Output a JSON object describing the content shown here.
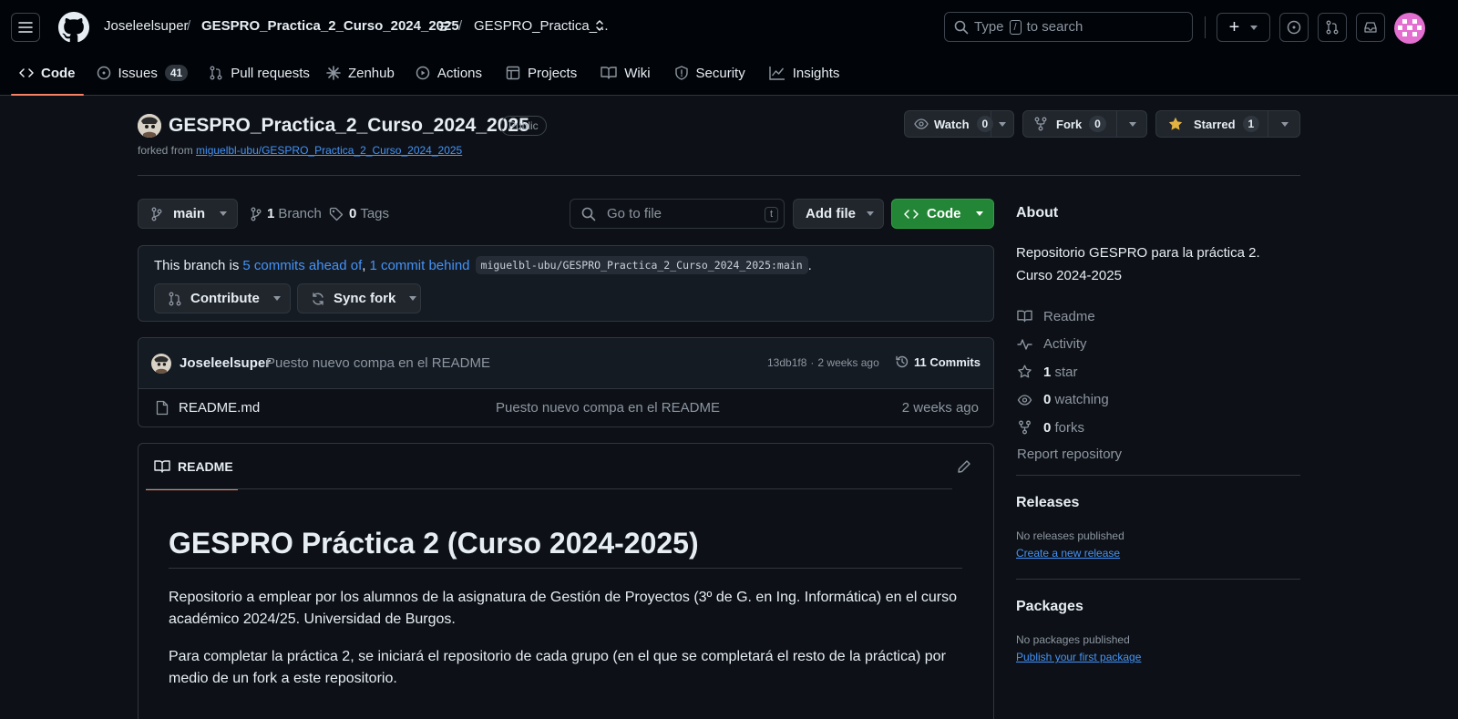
{
  "header": {
    "owner": "Joseleelsuper",
    "separator": "/",
    "repo": "GESPRO_Practica_2_Curso_2024_2025",
    "branch_switcher": "GESPRO_Practica_...",
    "search_text_before": "Type",
    "search_key": "/",
    "search_text_after": "to search",
    "plus_label": "+"
  },
  "nav": {
    "tabs": [
      {
        "label": "Code",
        "icon": "code-icon"
      },
      {
        "label": "Issues",
        "icon": "issue-icon",
        "count": "41"
      },
      {
        "label": "Pull requests",
        "icon": "pull-request-icon"
      },
      {
        "label": "Zenhub",
        "icon": "zenhub-icon"
      },
      {
        "label": "Actions",
        "icon": "play-icon"
      },
      {
        "label": "Projects",
        "icon": "table-icon"
      },
      {
        "label": "Wiki",
        "icon": "book-icon"
      },
      {
        "label": "Security",
        "icon": "shield-icon"
      },
      {
        "label": "Insights",
        "icon": "graph-icon"
      }
    ]
  },
  "repo": {
    "name": "GESPRO_Practica_2_Curso_2024_2025",
    "visibility": "Public",
    "forked_prefix": "forked from",
    "forked_from": "miguelbl-ubu/GESPRO_Practica_2_Curso_2024_2025",
    "watch_label": "Watch",
    "watch_count": "0",
    "fork_label": "Fork",
    "fork_count": "0",
    "star_label": "Starred",
    "star_count": "1"
  },
  "toolbar": {
    "branch": "main",
    "branch_count": "1",
    "branch_label": "Branch",
    "tag_count": "0",
    "tag_label": "Tags",
    "goto_placeholder": "Go to file",
    "goto_key": "t",
    "add_file": "Add file",
    "code": "Code"
  },
  "branch_status": {
    "prefix": "This branch is",
    "ahead": "5 commits ahead of",
    "comma": ",",
    "behind": "1 commit behind",
    "upstream": "miguelbl-ubu/GESPRO_Practica_2_Curso_2024_2025:main",
    "suffix": ".",
    "contribute": "Contribute",
    "sync": "Sync fork"
  },
  "commit": {
    "author": "Joseleelsuper",
    "message": "Puesto nuevo compa en el README",
    "sha": "13db1f8",
    "dot": "·",
    "time": "2 weeks ago",
    "commits_count": "11 Commits"
  },
  "files": [
    {
      "name": "README.md",
      "message": "Puesto nuevo compa en el README",
      "time": "2 weeks ago"
    }
  ],
  "readme": {
    "tab": "README",
    "title": "GESPRO Práctica 2 (Curso 2024-2025)",
    "p1": "Repositorio a emplear por los alumnos de la asignatura de Gestión de Proyectos (3º de G. en Ing. Informática) en el curso académico 2024/25. Universidad de Burgos.",
    "p2": "Para completar la práctica 2, se iniciará el repositorio de cada grupo (en el que se completará el resto de la práctica) por medio de un fork a este repositorio."
  },
  "about": {
    "title": "About",
    "description": "Repositorio GESPRO para la práctica 2. Curso 2024-2025",
    "readme": "Readme",
    "activity": "Activity",
    "stars_count": "1",
    "stars_label": "star",
    "watching_count": "0",
    "watching_label": "watching",
    "forks_count": "0",
    "forks_label": "forks",
    "report": "Report repository"
  },
  "releases": {
    "title": "Releases",
    "empty": "No releases published",
    "create": "Create a new release"
  },
  "packages": {
    "title": "Packages",
    "empty": "No packages published",
    "publish": "Publish your first package"
  },
  "colors": {
    "bg": "#0d1117",
    "header_bg": "#010409",
    "border": "#30363d",
    "link": "#4493f8",
    "green": "#238636",
    "tab_underline": "#f78166",
    "star": "#e3b341"
  }
}
